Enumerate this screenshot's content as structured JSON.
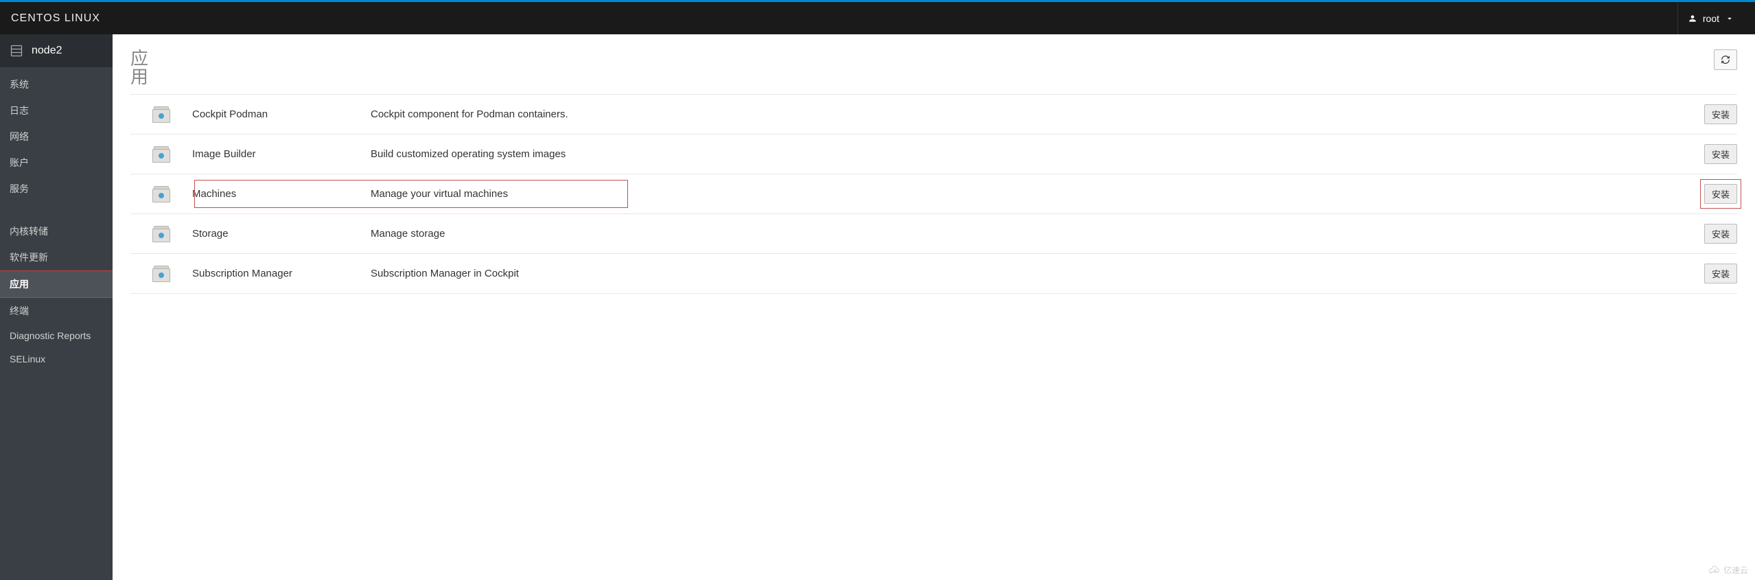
{
  "brand": "CENTOS LINUX",
  "user": {
    "name": "root"
  },
  "host": "node2",
  "sidebar": {
    "items": [
      {
        "label": "系统",
        "active": false
      },
      {
        "label": "日志",
        "active": false
      },
      {
        "label": "网络",
        "active": false
      },
      {
        "label": "账户",
        "active": false
      },
      {
        "label": "服务",
        "active": false
      }
    ],
    "items2": [
      {
        "label": "内核转储",
        "active": false
      },
      {
        "label": "软件更新",
        "active": false
      },
      {
        "label": "应用",
        "active": true
      },
      {
        "label": "终端",
        "active": false
      },
      {
        "label": "Diagnostic Reports",
        "active": false
      },
      {
        "label": "SELinux",
        "active": false
      }
    ]
  },
  "page": {
    "title": "应用",
    "install_label": "安装"
  },
  "apps": [
    {
      "name": "Cockpit Podman",
      "desc": "Cockpit component for Podman containers.",
      "highlight": false
    },
    {
      "name": "Image Builder",
      "desc": "Build customized operating system images",
      "highlight": false
    },
    {
      "name": "Machines",
      "desc": "Manage your virtual machines",
      "highlight": true
    },
    {
      "name": "Storage",
      "desc": "Manage storage",
      "highlight": false
    },
    {
      "name": "Subscription Manager",
      "desc": "Subscription Manager in Cockpit",
      "highlight": false
    }
  ],
  "watermark": "亿速云"
}
